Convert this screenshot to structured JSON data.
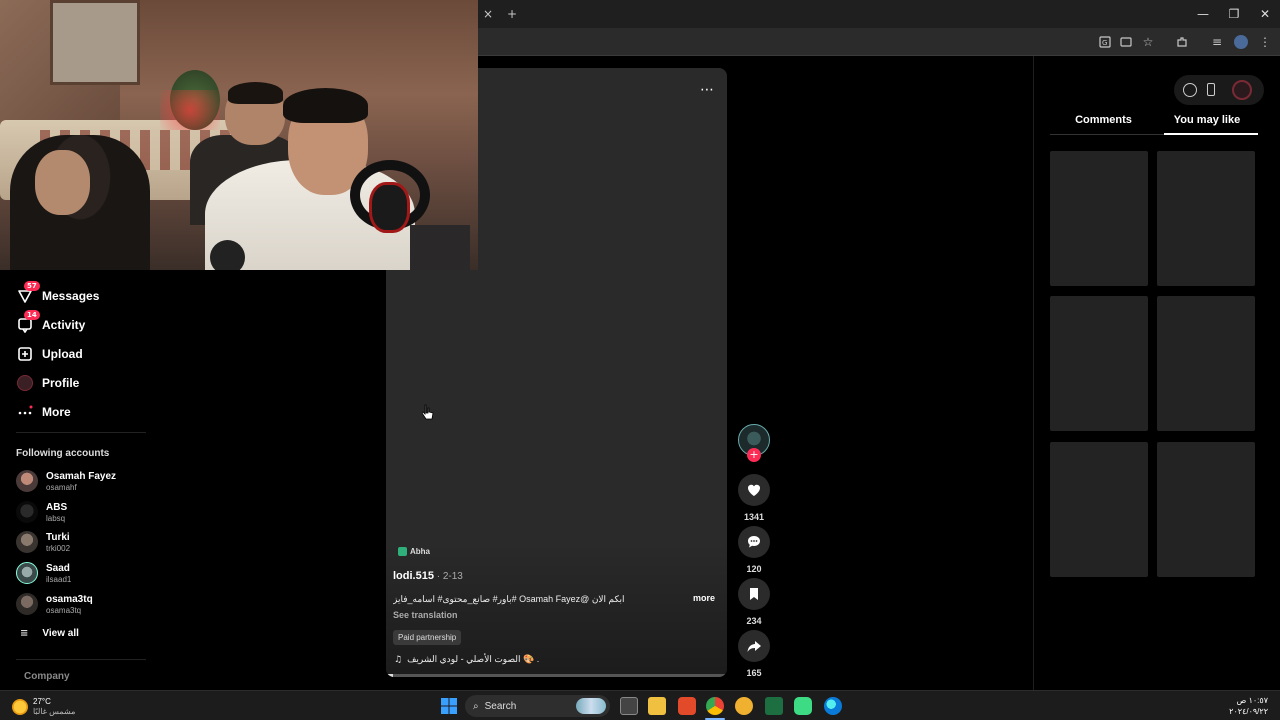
{
  "browser": {
    "close_tab_glyph": "×",
    "new_tab_glyph": "+",
    "toolbar_icons": [
      "translate-icon",
      "cast-icon",
      "star-icon",
      "extensions-icon",
      "media-icon",
      "profile-icon",
      "menu-icon"
    ]
  },
  "sidebar": {
    "items": [
      {
        "label": "Messages",
        "icon": "messages-icon",
        "badge": "57"
      },
      {
        "label": "Activity",
        "icon": "activity-icon",
        "badge": "14"
      },
      {
        "label": "Upload",
        "icon": "upload-icon",
        "badge": ""
      },
      {
        "label": "Profile",
        "icon": "profile-avatar",
        "badge": ""
      },
      {
        "label": "More",
        "icon": "more-icon",
        "badge": ""
      }
    ],
    "following_title": "Following accounts",
    "accounts": [
      {
        "name": "Osamah Fayez",
        "handle": "osamahf"
      },
      {
        "name": "ABS",
        "handle": "labsq"
      },
      {
        "name": "Turki",
        "handle": "trki002"
      },
      {
        "name": "Saad",
        "handle": "ilsaad1"
      },
      {
        "name": "osama3tq",
        "handle": "osama3tq"
      }
    ],
    "view_all": "View all",
    "company": "Company"
  },
  "video": {
    "location": "Abha",
    "author": "lodi.515",
    "date": " · 2-13",
    "caption": "باور# صانع_محتوى# اسامه_فايز# Osamah Fayez@ ابكم الان",
    "more_label": "more",
    "see_translation": "See translation",
    "paid_label": "Paid partnership",
    "sound_note": "♫",
    "sound": "الصوت الأصلي - لودي الشريف 🎨 .",
    "progress": 0.02
  },
  "actions": {
    "like_count": "1341",
    "comment_count": "120",
    "save_count": "234",
    "share_count": "165"
  },
  "right_panel": {
    "tab_comments": "Comments",
    "tab_you_may_like": "You may like",
    "active_tab": "You may like"
  },
  "taskbar": {
    "temp": "27°C",
    "weather": "مشمس غالبًا",
    "search": "Search",
    "time": "١٠:٥٧ ص",
    "date": "٢٠٢٤/٠٩/٢٢"
  },
  "colors": {
    "accent": "#fe2c55",
    "panel": "#2a2a2a",
    "tile": "#232323"
  }
}
